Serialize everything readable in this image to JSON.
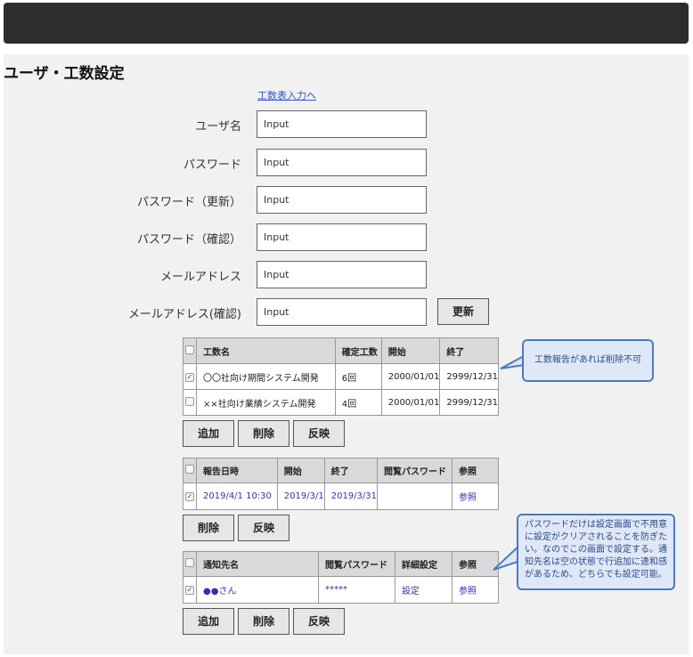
{
  "page_title": "ユーザ・工数設定",
  "link_text": "工数表入力へ",
  "form": {
    "fields": [
      {
        "label": "ユーザ名",
        "value": "Input"
      },
      {
        "label": "パスワード",
        "value": "Input"
      },
      {
        "label": "パスワード（更新）",
        "value": "Input"
      },
      {
        "label": "パスワード（確認）",
        "value": "Input"
      },
      {
        "label": "メールアドレス",
        "value": "Input"
      },
      {
        "label": "メールアドレス(確認)",
        "value": "Input"
      }
    ],
    "update_button": "更新"
  },
  "kousuu_table": {
    "headers": [
      "工数名",
      "確定工数",
      "開始",
      "終了"
    ],
    "rows": [
      {
        "checked": true,
        "name": "〇〇社向け期間システム開発",
        "count": "6回",
        "start": "2000/01/01",
        "end": "2999/12/31"
      },
      {
        "checked": false,
        "name": "××社向け業績システム開発",
        "count": "4回",
        "start": "2000/01/01",
        "end": "2999/12/31"
      }
    ],
    "buttons": {
      "add": "追加",
      "delete": "削除",
      "apply": "反映"
    }
  },
  "report_table": {
    "headers": [
      "報告日時",
      "開始",
      "終了",
      "閲覧パスワード",
      "参照"
    ],
    "rows": [
      {
        "checked": true,
        "datetime": "2019/4/1 10:30",
        "start": "2019/3/1",
        "end": "2019/3/31",
        "password": "",
        "ref": "参照"
      }
    ],
    "buttons": {
      "delete": "削除",
      "apply": "反映"
    }
  },
  "notify_table": {
    "headers": [
      "通知先名",
      "閲覧パスワード",
      "詳細設定",
      "参照"
    ],
    "rows": [
      {
        "checked": true,
        "name": "●●さん",
        "password": "*****",
        "detail": "設定",
        "ref": "参照"
      }
    ],
    "buttons": {
      "add": "追加",
      "delete": "削除",
      "apply": "反映"
    }
  },
  "callouts": {
    "tip1": "工数報告があれば削除不可",
    "tip2": "パスワードだけは設定画面で不用意に設定がクリアされることを防ぎたい。なのでこの画面で設定する。通知先名は空の状態で行追加に違和感があるため、どちらでも設定可能。"
  },
  "colors": {
    "topbar": "#2d2d2d",
    "callout_bg": "#e0e8f7",
    "callout_border": "#4b7ac0",
    "link": "#3a2fa8"
  }
}
